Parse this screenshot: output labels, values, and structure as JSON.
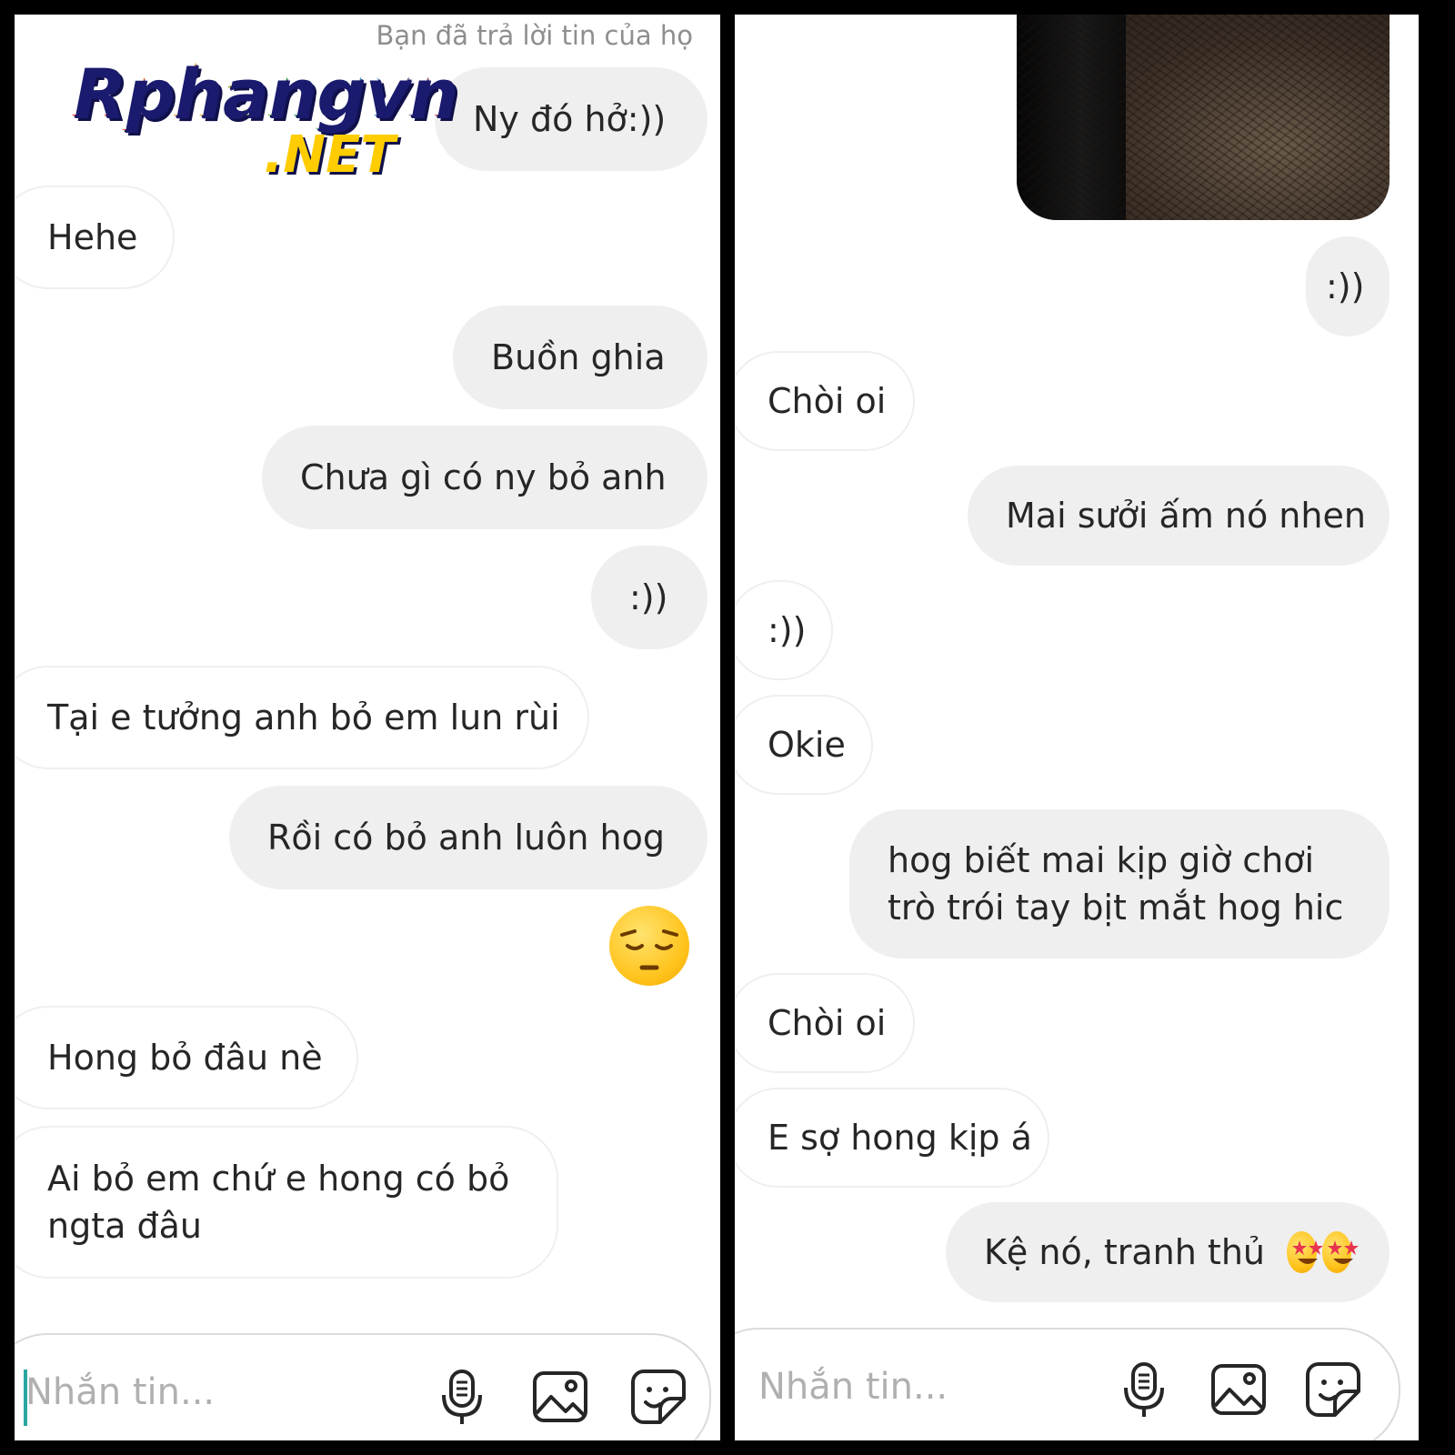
{
  "watermark": {
    "brand": "Rphangvn",
    "suffix": ".NET"
  },
  "left_panel": {
    "status_text": "Bạn đã trả lời tin của họ",
    "messages": [
      {
        "side": "out",
        "text": "Ny đó hở:))"
      },
      {
        "side": "in",
        "text": "Hehe"
      },
      {
        "side": "out",
        "text": "Buồn ghia"
      },
      {
        "side": "out",
        "text": "Chưa gì có ny bỏ anh"
      },
      {
        "side": "out",
        "text": ":))"
      },
      {
        "side": "in",
        "text": "Tại e tưởng anh bỏ em lun rùi"
      },
      {
        "side": "out",
        "text": "Rồi có bỏ anh luôn hog"
      },
      {
        "side": "out",
        "emoji": "pensive-face"
      },
      {
        "side": "in",
        "text": "Hong bỏ đâu nè"
      },
      {
        "side": "in",
        "text": "Ai bỏ em chứ e hong có bỏ ngta đâu"
      }
    ],
    "composer": {
      "placeholder": "Nhắn tin...",
      "icons": [
        "microphone-icon",
        "image-icon",
        "sticker-icon"
      ]
    }
  },
  "right_panel": {
    "messages": [
      {
        "side": "out",
        "type": "photo"
      },
      {
        "side": "out",
        "text": ":))"
      },
      {
        "side": "in",
        "text": "Chòi oi"
      },
      {
        "side": "out",
        "text": "Mai sưởi ấm nó nhen"
      },
      {
        "side": "in",
        "text": ":))"
      },
      {
        "side": "in",
        "text": "Okie"
      },
      {
        "side": "out",
        "text": "hog biết mai kịp giờ chơi trò trói tay bịt mắt hog hic"
      },
      {
        "side": "in",
        "text": "Chòi oi"
      },
      {
        "side": "in",
        "text": "E sợ hong kịp á"
      },
      {
        "side": "out",
        "text": "Kệ nó, tranh thủ",
        "emoji": "star-struck-face"
      }
    ],
    "composer": {
      "placeholder": "Nhắn tin...",
      "icons": [
        "microphone-icon",
        "image-icon",
        "sticker-icon"
      ]
    }
  }
}
